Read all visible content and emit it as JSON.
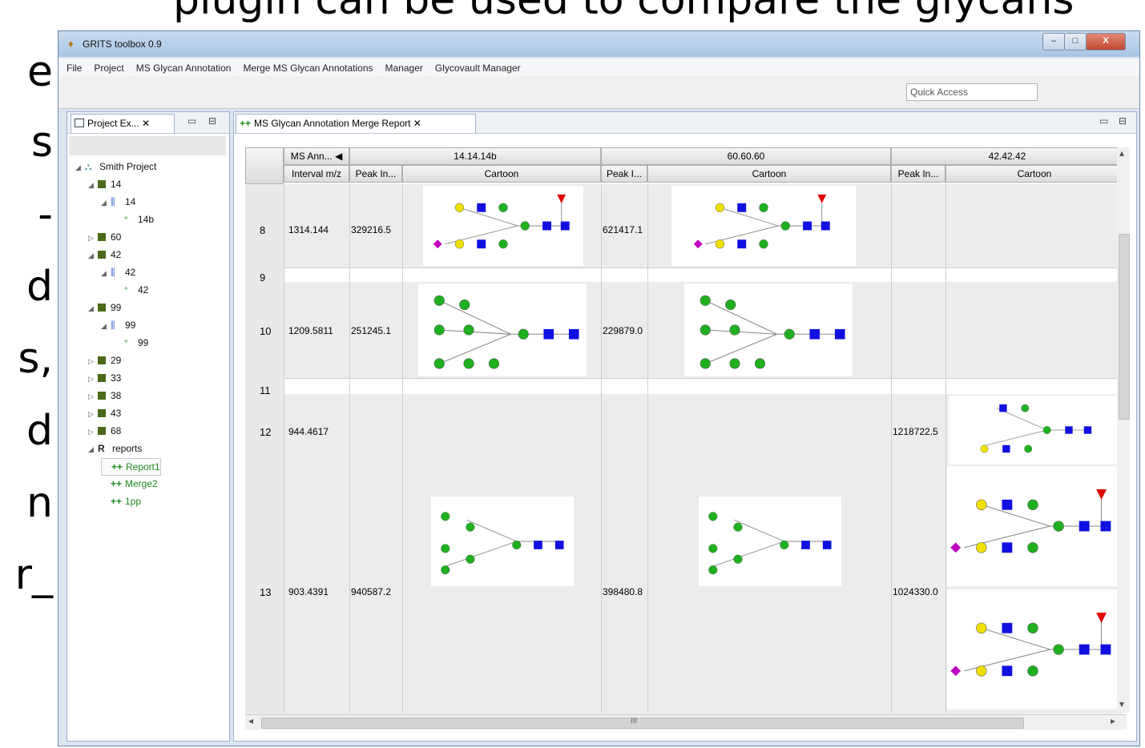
{
  "slide": {
    "top_text": "plugin can be used to compare the glycans",
    "side_letters": [
      "e",
      "s",
      "-",
      "d",
      "s,",
      "d",
      "n",
      "r_"
    ]
  },
  "window": {
    "title": "GRITS toolbox 0.9",
    "minimize_label": "–",
    "maximize_label": "□",
    "close_label": "X"
  },
  "menu": [
    "File",
    "Project",
    "MS Glycan Annotation",
    "Merge MS Glycan Annotations",
    "Manager",
    "Glycovault Manager"
  ],
  "toolbar": {
    "quick_access": "Quick Access"
  },
  "left_panel": {
    "tab_label": "Project Ex... ✕",
    "min_label": "▭",
    "max_label": "⊟",
    "tree": [
      {
        "label": "Smith Project",
        "indent": 0,
        "arrow": "◢",
        "icon": "project-icon"
      },
      {
        "label": "14",
        "indent": 1,
        "arrow": "◢",
        "icon": "sample-icon"
      },
      {
        "label": "14",
        "indent": 2,
        "arrow": "◢",
        "icon": "ms-icon"
      },
      {
        "label": "14b",
        "indent": 3,
        "arrow": "",
        "icon": "annotation-icon"
      },
      {
        "label": "60",
        "indent": 1,
        "arrow": "▷",
        "icon": "sample-icon"
      },
      {
        "label": "42",
        "indent": 1,
        "arrow": "◢",
        "icon": "sample-icon"
      },
      {
        "label": "42",
        "indent": 2,
        "arrow": "◢",
        "icon": "ms-icon"
      },
      {
        "label": "42",
        "indent": 3,
        "arrow": "",
        "icon": "annotation-icon"
      },
      {
        "label": "99",
        "indent": 1,
        "arrow": "◢",
        "icon": "sample-icon"
      },
      {
        "label": "99",
        "indent": 2,
        "arrow": "◢",
        "icon": "ms-icon"
      },
      {
        "label": "99",
        "indent": 3,
        "arrow": "",
        "icon": "annotation-icon"
      },
      {
        "label": "29",
        "indent": 1,
        "arrow": "▷",
        "icon": "sample-icon"
      },
      {
        "label": "33",
        "indent": 1,
        "arrow": "▷",
        "icon": "sample-icon"
      },
      {
        "label": "38",
        "indent": 1,
        "arrow": "▷",
        "icon": "sample-icon"
      },
      {
        "label": "43",
        "indent": 1,
        "arrow": "▷",
        "icon": "sample-icon"
      },
      {
        "label": "68",
        "indent": 1,
        "arrow": "▷",
        "icon": "sample-icon"
      },
      {
        "label": "reports",
        "indent": 1,
        "arrow": "◢",
        "icon": "reports-icon"
      },
      {
        "label": "Report1",
        "indent": 2,
        "arrow": "",
        "icon": "merge-icon",
        "green": true,
        "selected": true
      },
      {
        "label": "Merge2",
        "indent": 2,
        "arrow": "",
        "icon": "merge-icon",
        "green": true
      },
      {
        "label": "1pp",
        "indent": 2,
        "arrow": "",
        "icon": "merge-icon",
        "green": true
      }
    ]
  },
  "report": {
    "tab_label": "MS Glycan Annotation Merge Report ✕",
    "min_label": "▭",
    "max_label": "⊟",
    "group_headers": [
      "MS Ann... ◀",
      "14.14.14b",
      "60.60.60",
      "42.42.42"
    ],
    "col_headers": [
      "Interval m/z",
      "Peak In...",
      "Cartoon",
      "Peak I...",
      "Cartoon",
      "Peak In...",
      "Cartoon"
    ],
    "rows": [
      {
        "num": "8",
        "mz": "1314.144",
        "p1": "329216.5",
        "p2": "621417.1",
        "p3": ""
      },
      {
        "num": "9",
        "mz": "",
        "p1": "",
        "p2": "",
        "p3": ""
      },
      {
        "num": "10",
        "mz": "1209.5811",
        "p1": "251245.1",
        "p2": "229879.0",
        "p3": ""
      },
      {
        "num": "11",
        "mz": "",
        "p1": "",
        "p2": "",
        "p3": ""
      },
      {
        "num": "12",
        "mz": "944.4617",
        "p1": "",
        "p2": "",
        "p3": "1218722.5"
      },
      {
        "num": "13",
        "mz": "903.4391",
        "p1": "940587.2",
        "p2": "398480.8",
        "p3": "1024330.0"
      }
    ],
    "hscroll_mark": "III",
    "scroll_left": "◂",
    "scroll_right": "▸",
    "scroll_up": "▴",
    "scroll_down": "▾"
  }
}
